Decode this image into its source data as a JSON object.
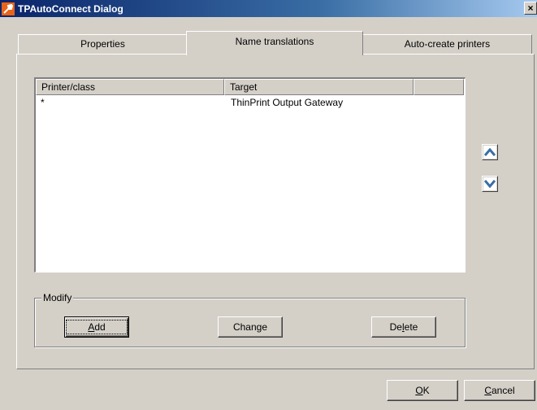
{
  "window": {
    "title": "TPAutoConnect Dialog",
    "close_glyph": "×",
    "app_icon": "wrench-icon"
  },
  "tabs": [
    {
      "label": "Properties",
      "active": false
    },
    {
      "label": "Name translations",
      "active": true
    },
    {
      "label": "Auto-create printers",
      "active": false
    }
  ],
  "list": {
    "columns": [
      "Printer/class",
      "Target"
    ],
    "rows": [
      {
        "printer": "*",
        "target": "ThinPrint Output Gateway"
      }
    ]
  },
  "arrows": {
    "up_icon": "arrow-up-icon",
    "down_icon": "arrow-down-icon"
  },
  "modify": {
    "label": "Modify",
    "add": {
      "pre": "",
      "key": "A",
      "post": "dd"
    },
    "change": {
      "pre": "Chan",
      "key": "g",
      "post": "e"
    },
    "delete": {
      "pre": "De",
      "key": "l",
      "post": "ete"
    }
  },
  "footer": {
    "ok": {
      "pre": "",
      "key": "O",
      "post": "K"
    },
    "cancel": {
      "pre": "",
      "key": "C",
      "post": "ancel"
    }
  }
}
